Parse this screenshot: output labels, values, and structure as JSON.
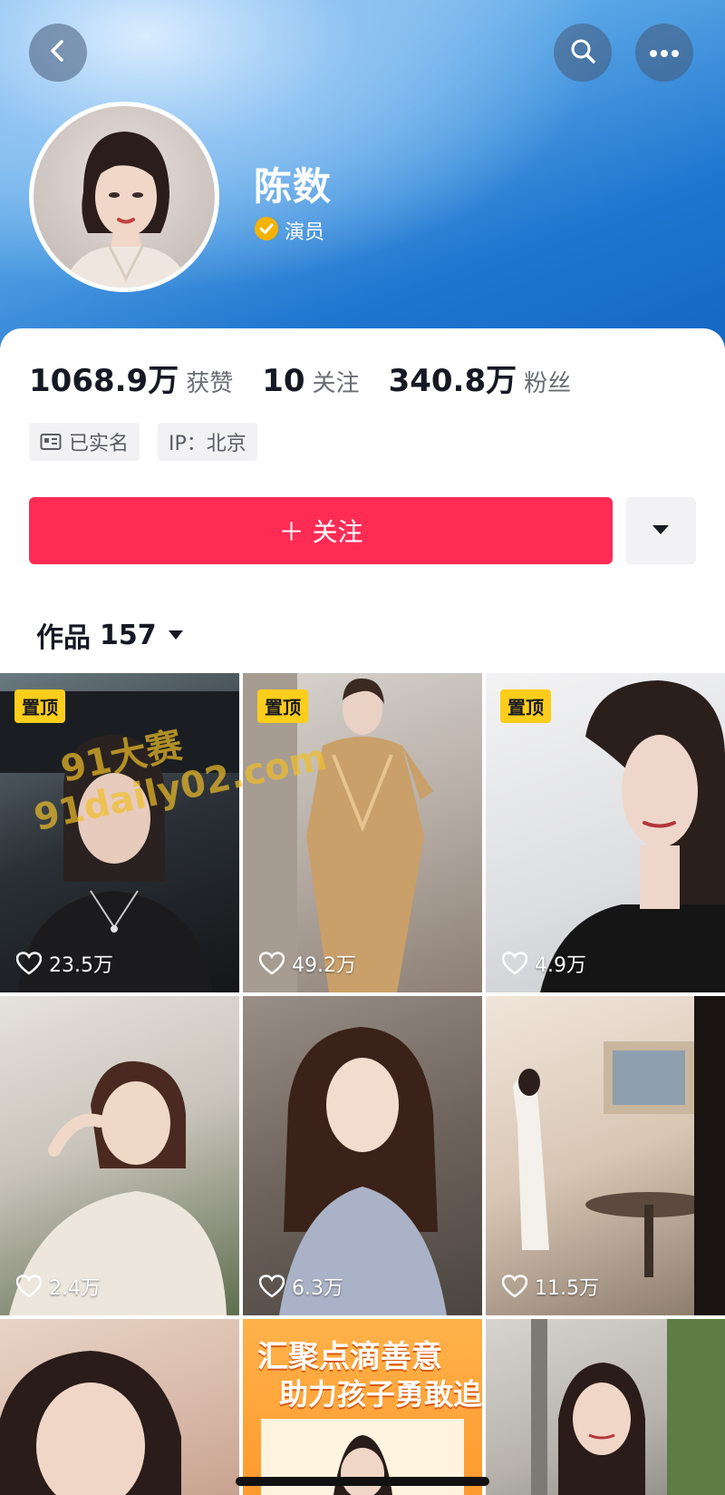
{
  "profile": {
    "name": "陈数",
    "verify_label": "演员"
  },
  "stats": [
    {
      "num": "1068.9万",
      "label": "获赞"
    },
    {
      "num": "10",
      "label": "关注"
    },
    {
      "num": "340.8万",
      "label": "粉丝"
    }
  ],
  "tags": {
    "id_label": "已实名",
    "ip_label": "IP：北京"
  },
  "actions": {
    "follow_label": "＋ 关注"
  },
  "works": {
    "label": "作品",
    "count": "157"
  },
  "videos": [
    {
      "pinned": "置顶",
      "likes": "23.5万"
    },
    {
      "pinned": "置顶",
      "likes": "49.2万"
    },
    {
      "pinned": "置顶",
      "likes": "4.9万"
    },
    {
      "likes": "2.4万"
    },
    {
      "likes": "6.3万"
    },
    {
      "likes": "11.5万"
    }
  ],
  "banner": {
    "line1": "汇聚点滴善意",
    "line2": "助力孩子勇敢追梦"
  },
  "watermark": {
    "line1": "91大赛",
    "line2": "91daily02.com"
  },
  "colors": {
    "accent": "#fe2c55",
    "pin_badge": "#fccd1a",
    "verify_badge": "#f5b301"
  }
}
